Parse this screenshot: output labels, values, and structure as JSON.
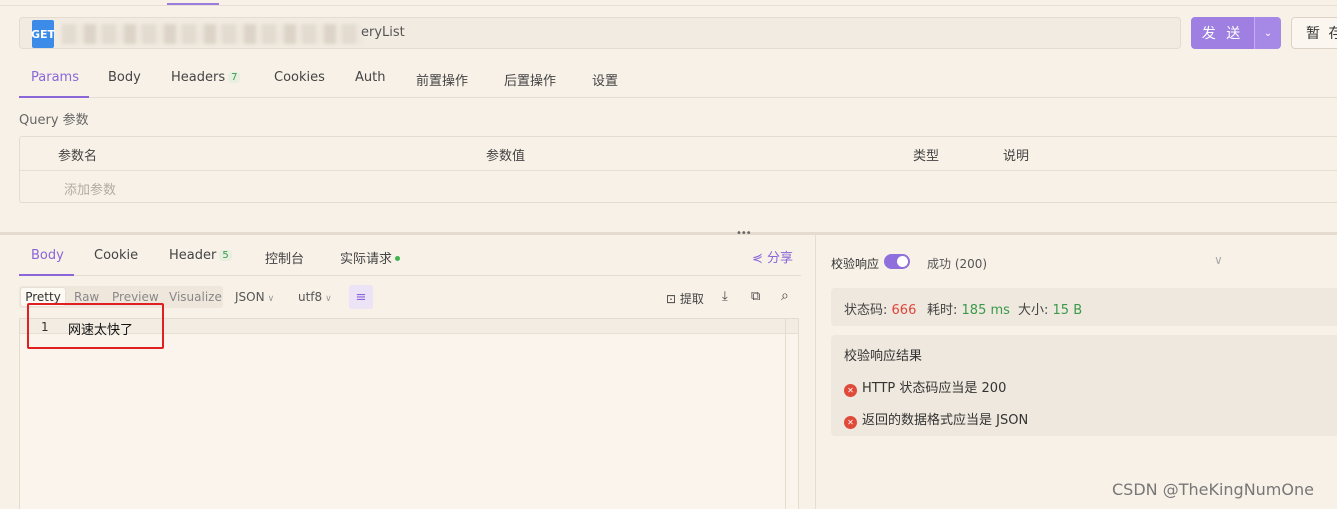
{
  "url_bar": {
    "method": "GET",
    "url_visible_suffix": "eryList",
    "send_label": "发 送",
    "save_label": "暂 存"
  },
  "request_tabs": [
    {
      "label": "Params",
      "active": true
    },
    {
      "label": "Body"
    },
    {
      "label": "Headers",
      "count": "7"
    },
    {
      "label": "Cookies"
    },
    {
      "label": "Auth"
    },
    {
      "label": "前置操作"
    },
    {
      "label": "后置操作"
    },
    {
      "label": "设置"
    }
  ],
  "query": {
    "section_label": "Query 参数",
    "columns": [
      "参数名",
      "参数值",
      "类型",
      "说明"
    ],
    "add_placeholder": "添加参数"
  },
  "response_tabs": [
    {
      "label": "Body",
      "active": true
    },
    {
      "label": "Cookie"
    },
    {
      "label": "Header",
      "count": "5"
    },
    {
      "label": "控制台"
    },
    {
      "label": "实际请求"
    }
  ],
  "share_label": "分享",
  "format_bar": {
    "modes": [
      "Pretty",
      "Raw",
      "Preview",
      "Visualize"
    ],
    "format_value": "JSON",
    "encoding_value": "utf8",
    "extract_label": "提取"
  },
  "editor": {
    "line_number": "1",
    "line_text": "网速太快了"
  },
  "validation": {
    "toggle_label": "校验响应",
    "toggle_on": true,
    "status_text": "成功 (200)",
    "stats": {
      "status_code_label": "状态码:",
      "status_code_value": "666",
      "time_label": "耗时:",
      "time_value": "185 ms",
      "size_label": "大小:",
      "size_value": "15 B"
    },
    "results_title": "校验响应结果",
    "results": [
      "HTTP 状态码应当是 200",
      "返回的数据格式应当是 JSON"
    ]
  },
  "watermark": "CSDN @TheKingNumOne",
  "colors": {
    "accent": "#8a66d8",
    "error": "#e04a3a",
    "success": "#3fb34f",
    "status_code": "#e0453a"
  }
}
